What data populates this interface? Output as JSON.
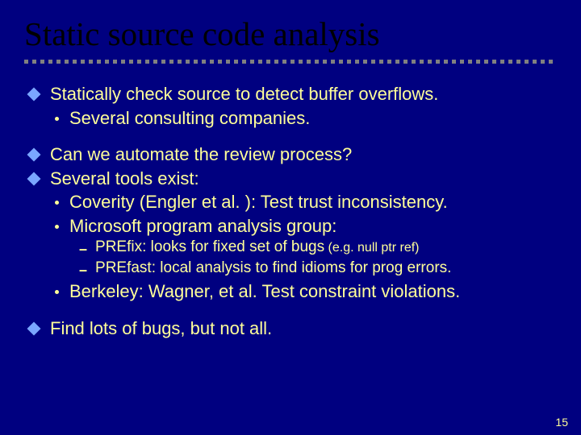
{
  "title": "Static source code analysis",
  "b1": "Statically check source to detect buffer overflows.",
  "b1s1": "Several consulting companies.",
  "b2": "Can we automate the review process?",
  "b3": "Several tools exist:",
  "b3s1": "Coverity (Engler et al. ):    Test trust inconsistency.",
  "b3s2": "Microsoft program analysis group:",
  "b3s2a_lead": "PREfix:",
  "b3s2a_rest": "   looks for fixed set of bugs",
  "b3s2a_note": "  (e.g. null ptr ref)",
  "b3s2b_lead": "PREfast:",
  "b3s2b_rest": "  local analysis to find idioms for prog errors.",
  "b3s3": "Berkeley:  Wagner, et al.  Test constraint violations.",
  "b4": "Find lots of bugs, but not all.",
  "page": "15"
}
